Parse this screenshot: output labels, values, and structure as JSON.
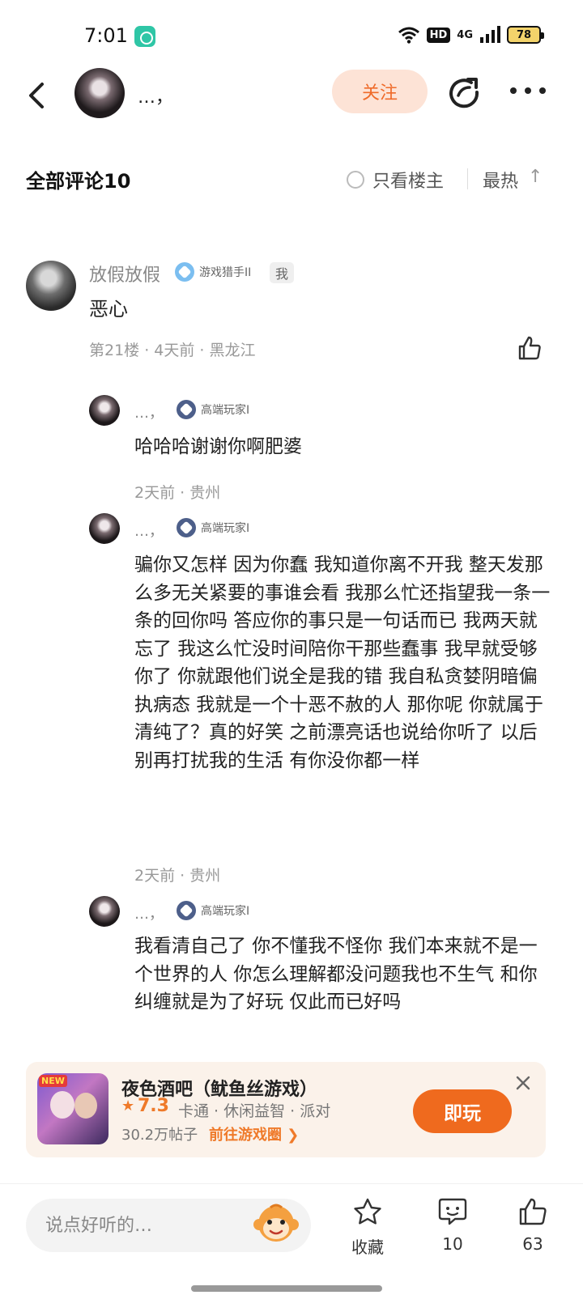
{
  "status_bar": {
    "time": "7:01",
    "hd": "HD",
    "network": "4G",
    "battery": "78"
  },
  "header": {
    "name": "…，",
    "follow_label": "关注"
  },
  "section": {
    "title": "全部评论10",
    "only_host_label": "只看楼主",
    "sort_label": "最热",
    "sort_more": "↑L"
  },
  "main_comment": {
    "name": "放假放假",
    "level": "游戏猎手II",
    "me_tag": "我",
    "text": "恶心",
    "meta": "第21楼 · 4天前 · 黑龙江"
  },
  "replies": [
    {
      "name": "…，",
      "level": "高端玩家I",
      "text": "哈哈哈谢谢你啊肥婆",
      "meta": "2天前 · 贵州"
    },
    {
      "name": "…，",
      "level": "高端玩家I",
      "text": "骗你又怎样 因为你蠢 我知道你离不开我 整天发那么多无关紧要的事谁会看 我那么忙还指望我一条一条的回你吗 答应你的事只是一句话而已 我两天就忘了 我这么忙没时间陪你干那些蠢事 我早就受够你了 你就跟他们说全是我的错 我自私贪婪阴暗偏执病态 我就是一个十恶不赦的人 那你呢 你就属于清纯了？真的好笑 之前漂亮话也说给你听了 以后别再打扰我的生活 有你没你都一样",
      "meta": "2天前 · 贵州"
    },
    {
      "name": "…，",
      "level": "高端玩家I",
      "text": "我看清自己了 你不懂我不怪你 我们本来就不是一个世界的人 你怎么理解都没问题我也不生气 和你纠缠就是为了好玩 仅此而已好吗",
      "meta": ""
    }
  ],
  "game_card": {
    "new_tag": "NEW",
    "title": "夜色酒吧（鱿鱼丝游戏）",
    "star": "★",
    "rating": "7.3",
    "tags": "卡通 · 休闲益智 · 派对",
    "posts": "30.2万帖子",
    "link": "前往游戏圈 ❯",
    "play_label": "即玩"
  },
  "bottom_bar": {
    "input_placeholder": "说点好听的…",
    "favorite_label": "收藏",
    "comment_count": "10",
    "like_count": "63"
  },
  "colors": {
    "accent": "#ef6a1e",
    "follow_bg": "#fde3d6",
    "card_bg": "#fbf2ea"
  }
}
